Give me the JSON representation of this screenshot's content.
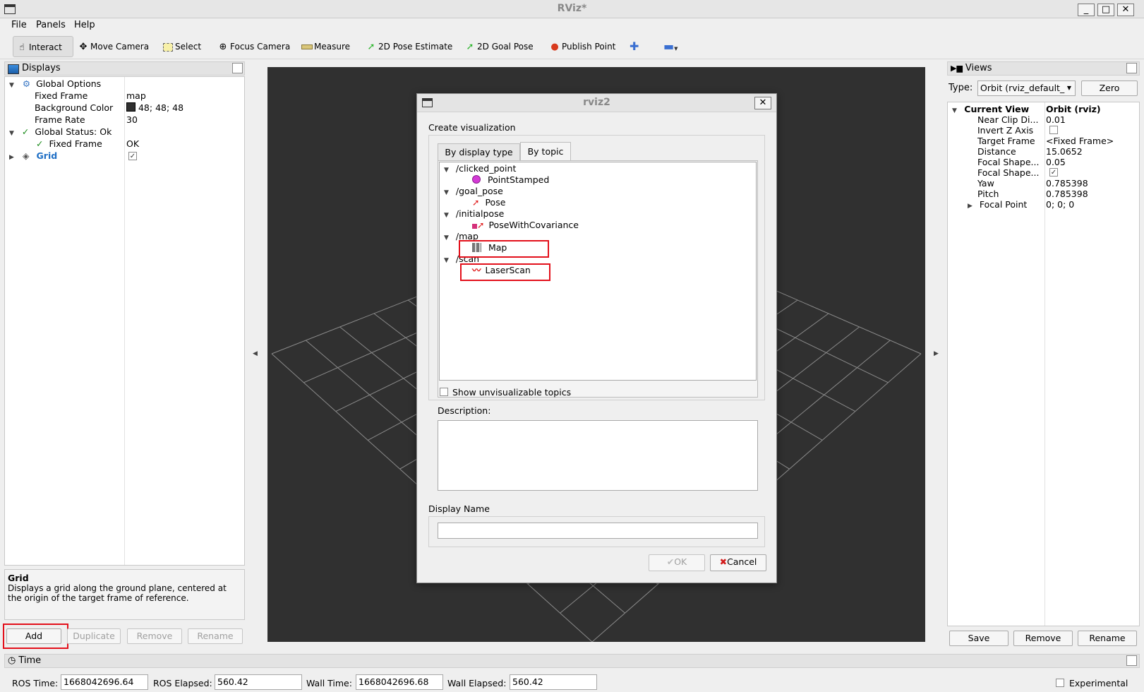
{
  "window": {
    "title": "RViz*",
    "minimize": "_",
    "maximize": "□",
    "close": "✕"
  },
  "menu": [
    "File",
    "Panels",
    "Help"
  ],
  "toolbar": [
    {
      "label": "Interact",
      "icon": "hand-pointer-icon",
      "active": true
    },
    {
      "label": "Move Camera",
      "icon": "move-camera-icon"
    },
    {
      "label": "Select",
      "icon": "select-box-icon"
    },
    {
      "label": "Focus Camera",
      "icon": "focus-crosshair-icon"
    },
    {
      "label": "Measure",
      "icon": "ruler-icon"
    },
    {
      "label": "2D Pose Estimate",
      "icon": "green-arrow-icon"
    },
    {
      "label": "2D Goal Pose",
      "icon": "green-arrow-icon"
    },
    {
      "label": "Publish Point",
      "icon": "map-pin-icon"
    }
  ],
  "displays": {
    "title": "Displays",
    "tree": [
      {
        "label": "Global Options",
        "value": ""
      },
      {
        "label": "Fixed Frame",
        "value": "map"
      },
      {
        "label": "Background Color",
        "value": "48; 48; 48"
      },
      {
        "label": "Frame Rate",
        "value": "30"
      },
      {
        "label": "Global Status: Ok",
        "value": ""
      },
      {
        "label": "Fixed Frame",
        "value": "OK"
      },
      {
        "label": "Grid",
        "value": ""
      }
    ],
    "description_title": "Grid",
    "description_text": "Displays a grid along the ground plane, centered at the origin of the target frame of reference.",
    "buttons": [
      "Add",
      "Duplicate",
      "Remove",
      "Rename"
    ]
  },
  "views": {
    "title": "Views",
    "type_label": "Type:",
    "type_value": "Orbit (rviz_default_",
    "zero_button": "Zero",
    "header_left": "Current View",
    "header_right": "Orbit (rviz)",
    "props": [
      {
        "label": "Near Clip Di...",
        "value": "0.01"
      },
      {
        "label": "Invert Z Axis",
        "value": ""
      },
      {
        "label": "Target Frame",
        "value": "<Fixed Frame>"
      },
      {
        "label": "Distance",
        "value": "15.0652"
      },
      {
        "label": "Focal Shape...",
        "value": "0.05"
      },
      {
        "label": "Focal Shape...",
        "value": ""
      },
      {
        "label": "Yaw",
        "value": "0.785398"
      },
      {
        "label": "Pitch",
        "value": "0.785398"
      },
      {
        "label": "Focal Point",
        "value": "0; 0; 0"
      }
    ],
    "buttons": [
      "Save",
      "Remove",
      "Rename"
    ]
  },
  "dialog": {
    "title": "rviz2",
    "close": "✕",
    "create_label": "Create visualization",
    "tabs": [
      "By display type",
      "By topic"
    ],
    "topics": [
      {
        "topic": "/clicked_point",
        "type": "PointStamped"
      },
      {
        "topic": "/goal_pose",
        "type": "Pose"
      },
      {
        "topic": "/initialpose",
        "type": "PoseWithCovariance"
      },
      {
        "topic": "/map",
        "type": "Map"
      },
      {
        "topic": "/scan",
        "type": "LaserScan"
      }
    ],
    "show_unvisualizable": "Show unvisualizable topics",
    "description_label": "Description:",
    "display_name_label": "Display Name",
    "ok": "OK",
    "cancel": "Cancel"
  },
  "time": {
    "title": "Time",
    "ros_time_label": "ROS Time:",
    "ros_time": "1668042696.64",
    "ros_elapsed_label": "ROS Elapsed:",
    "ros_elapsed": "560.42",
    "wall_time_label": "Wall Time:",
    "wall_time": "1668042696.68",
    "wall_elapsed_label": "Wall Elapsed:",
    "wall_elapsed": "560.42",
    "experimental": "Experimental"
  },
  "colors": {
    "viewport_bg": "#303030",
    "highlight": "#e3101b",
    "check_green": "#1a8a1a",
    "grid_label": "#1f6fc5"
  }
}
